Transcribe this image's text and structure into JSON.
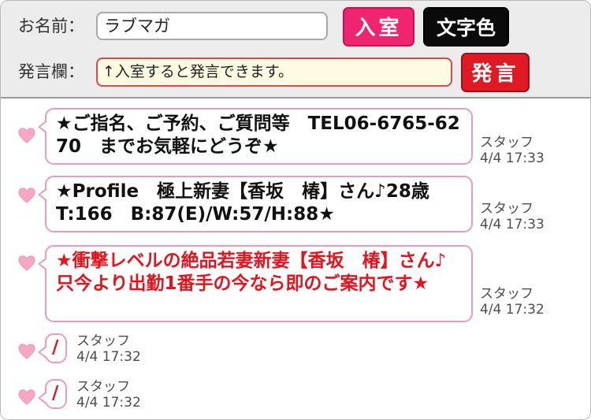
{
  "form": {
    "name_label": "お名前：",
    "name_value": "ラブマガ",
    "message_label": "発言欄：",
    "message_placeholder": "↑入室すると発言できます。",
    "enter_button": "入室",
    "color_button": "文字色",
    "speak_button": "発言"
  },
  "colors": {
    "enter_button": "#f0256f",
    "color_button": "#0b0b0b",
    "speak_button": "#df1a25",
    "bubble_border": "#f09ab6",
    "red_text": "#e5131d"
  },
  "icons": {
    "message_marker": "heart-icon"
  },
  "messages": [
    {
      "text": "★ご指名、ご予約、ご質問等　TEL06-6765-6270　までお気軽にどうぞ★",
      "author": "スタッフ",
      "time": "4/4 17:33"
    },
    {
      "text": "★Profile　極上新妻【香坂　椿】さん♪28歳　T:166　B:87(E)/W:57/H:88★",
      "author": "スタッフ",
      "time": "4/4 17:33"
    },
    {
      "text": "★衝撃レベルの絶品若妻新妻【香坂　椿】さん♪　只今より出勤1番手の今なら即のご案内です★",
      "author": "スタッフ",
      "time": "4/4 17:32"
    },
    {
      "text": "/",
      "author": "スタッフ",
      "time": "4/4 17:32"
    },
    {
      "text": "/",
      "author": "スタッフ",
      "time": "4/4 17:32"
    }
  ]
}
